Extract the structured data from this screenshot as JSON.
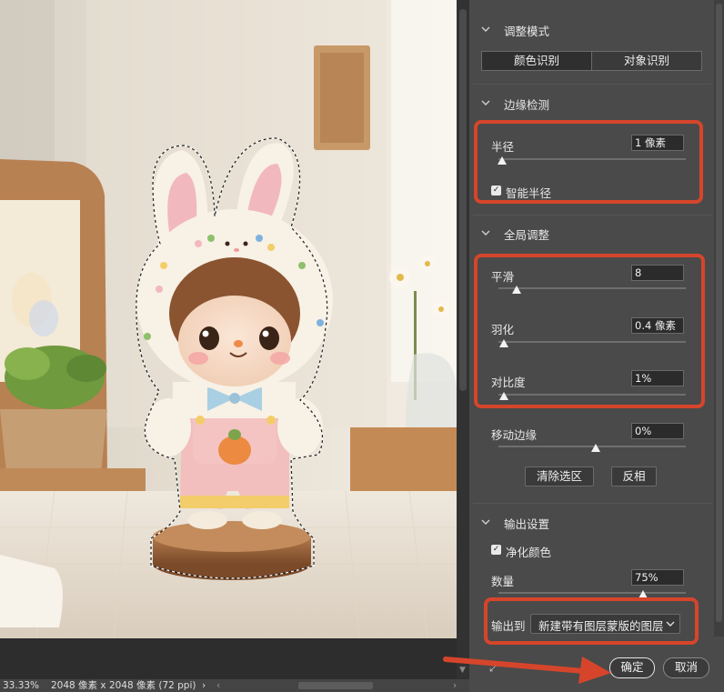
{
  "status_bar": {
    "zoom": "33.33%",
    "doc_info": "2048 像素 x 2048 像素 (72 ppi)",
    "nav_arrow": "›"
  },
  "panel": {
    "adjust_mode": {
      "title": "调整模式",
      "segments": [
        "颜色识别",
        "对象识别"
      ]
    },
    "edge_detection": {
      "title": "边缘检测",
      "radius_label": "半径",
      "radius_value": "1 像素",
      "radius_level": 0.0,
      "smart_radius_label": "智能半径",
      "smart_radius_checked": true
    },
    "global_adjust": {
      "title": "全局调整",
      "smooth_label": "平滑",
      "smooth_value": "8",
      "smooth_level": 0.08,
      "feather_label": "羽化",
      "feather_value": "0.4 像素",
      "feather_level": 0.01,
      "contrast_label": "对比度",
      "contrast_value": "1%",
      "contrast_level": 0.01,
      "shift_edge_label": "移动边缘",
      "shift_edge_value": "0%",
      "shift_edge_level": 0.5,
      "clear_selection_label": "清除选区",
      "invert_label": "反相"
    },
    "output": {
      "title": "输出设置",
      "decontaminate_label": "净化颜色",
      "decontaminate_checked": true,
      "amount_label": "数量",
      "amount_value": "75%",
      "amount_level": 0.75,
      "output_to_label": "输出到",
      "output_to_value": "新建带有图层蒙版的图层"
    },
    "ok_label": "确定",
    "cancel_label": "取消"
  },
  "colors": {
    "annotation": "#d6452b",
    "panel_bg": "#4a4a4a"
  }
}
